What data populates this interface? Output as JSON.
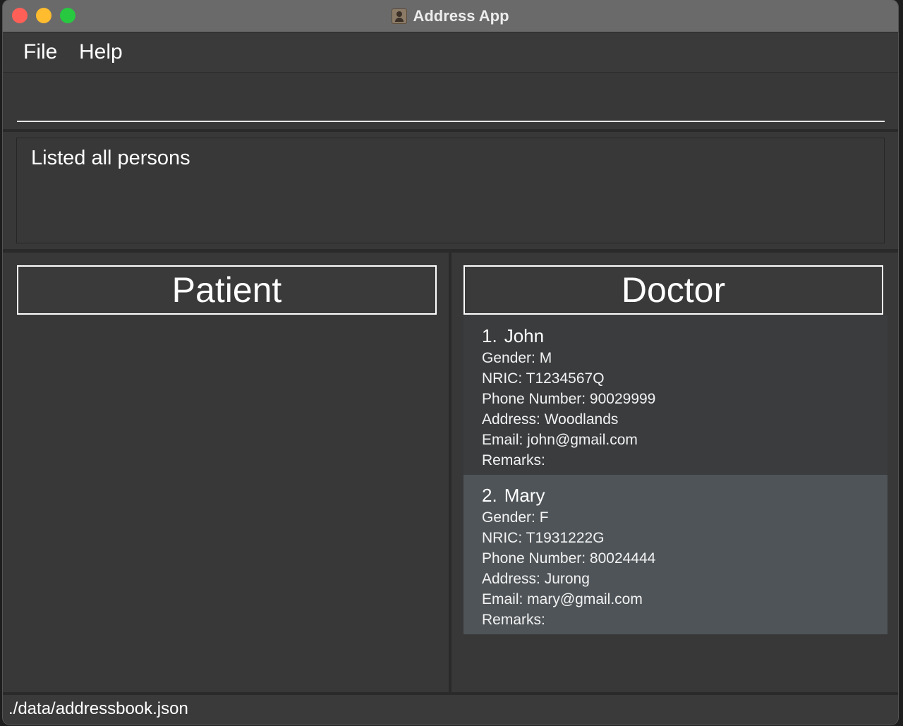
{
  "window": {
    "title": "Address App",
    "icon": "address-book-icon",
    "colors": {
      "close": "#fe5f57",
      "minimize": "#febc2e",
      "maximize": "#28c840"
    }
  },
  "menu": {
    "file_label": "File",
    "help_label": "Help"
  },
  "command": {
    "value": "",
    "placeholder": ""
  },
  "result": {
    "message": "Listed all persons"
  },
  "patient_panel": {
    "header": "Patient",
    "items": []
  },
  "doctor_panel": {
    "header": "Doctor",
    "items": [
      {
        "index": "1.",
        "name": "John",
        "gender": "Gender: M",
        "nric": "NRIC: T1234567Q",
        "phone": "Phone Number: 90029999",
        "address": "Address: Woodlands",
        "email": "Email: john@gmail.com",
        "remarks": "Remarks:"
      },
      {
        "index": "2.",
        "name": "Mary",
        "gender": "Gender: F",
        "nric": "NRIC: T1931222G",
        "phone": "Phone Number: 80024444",
        "address": "Address: Jurong",
        "email": "Email: mary@gmail.com",
        "remarks": "Remarks:"
      }
    ]
  },
  "status": {
    "file_path": "./data/addressbook.json"
  }
}
